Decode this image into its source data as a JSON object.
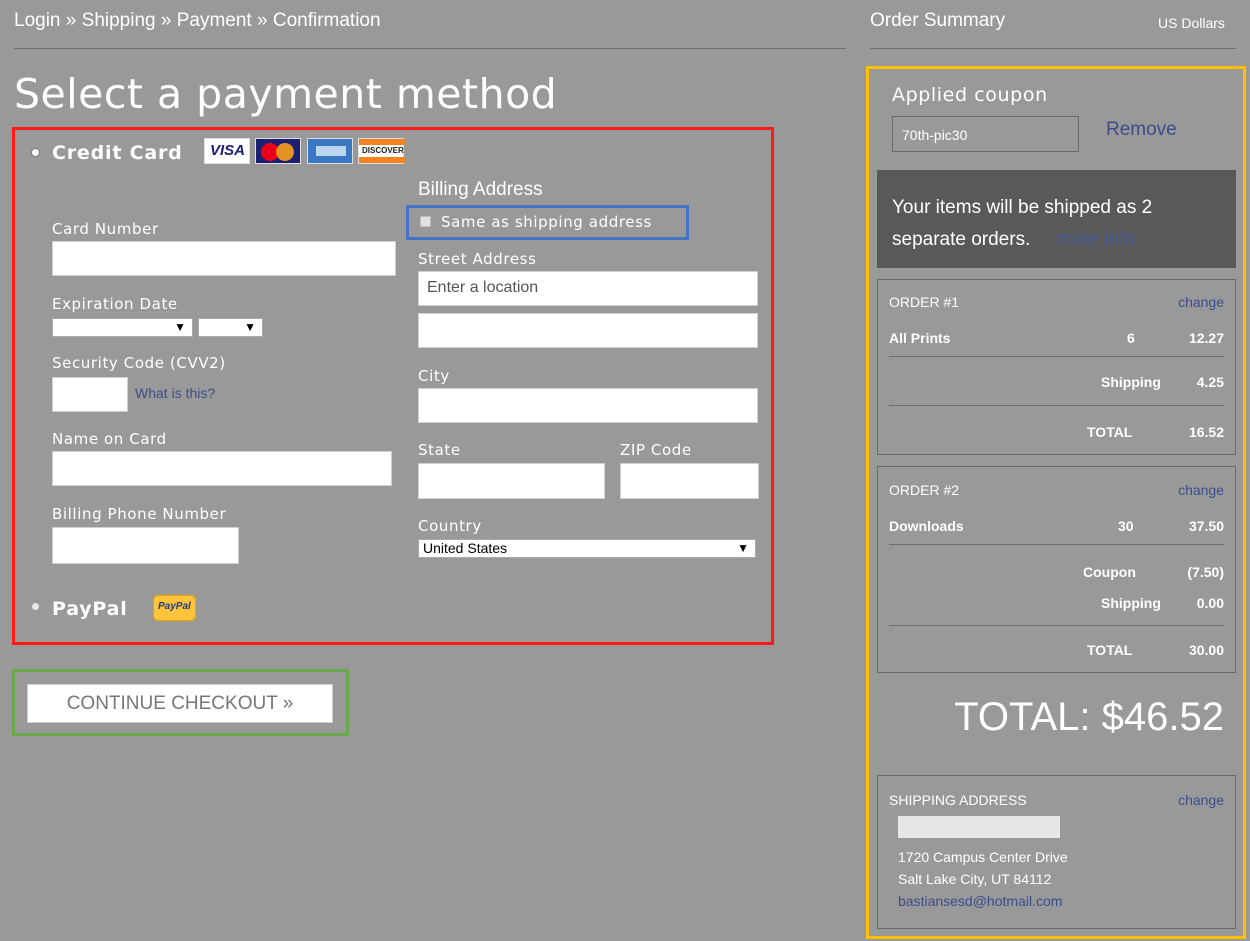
{
  "breadcrumb": [
    "Login",
    "»",
    "Shipping",
    "»",
    "Payment",
    "»",
    "Confirmation"
  ],
  "breadcrumb_text": "Login » Shipping » Payment » Confirmation",
  "page_title": "Select a payment method",
  "payment": {
    "credit_card_label": "Credit Card",
    "paypal_label": "PayPal",
    "card_brands": [
      "VISA",
      "MasterCard",
      "American Express",
      "DISCOVER"
    ],
    "paypal_badge": "PayPal",
    "card_number_label": "Card Number",
    "card_number_value": "",
    "expiration_label": "Expiration Date",
    "exp_month_value": "",
    "exp_year_value": "",
    "cvv_label": "Security Code (CVV2)",
    "cvv_value": "",
    "cvv_help": "What is this?",
    "name_label": "Name on Card",
    "name_value": "",
    "phone_label": "Billing Phone Number",
    "phone_value": ""
  },
  "billing": {
    "heading": "Billing Address",
    "same_as_shipping": "Same as shipping address",
    "street_label": "Street Address",
    "street_placeholder": "Enter a location",
    "street2_value": "",
    "city_label": "City",
    "city_value": "",
    "state_label": "State",
    "state_value": "",
    "zip_label": "ZIP Code",
    "zip_value": "",
    "country_label": "Country",
    "country_value": "United States"
  },
  "continue_button": "CONTINUE CHECKOUT »",
  "summary": {
    "title": "Order Summary",
    "currency": "US Dollars",
    "coupon_heading": "Applied coupon",
    "coupon_code": "70th-pic30",
    "coupon_remove": "Remove",
    "shipped_notice": "Your items will be shipped as 2 separate orders.",
    "more_info": "more info",
    "order1": {
      "title": "ORDER #1",
      "change": "change",
      "item_name": "All Prints",
      "item_qty": "6",
      "item_amount": "12.27",
      "shipping_label": "Shipping",
      "shipping_amount": "4.25",
      "total_label": "TOTAL",
      "total_amount": "16.52"
    },
    "order2": {
      "title": "ORDER #2",
      "change": "change",
      "item_name": "Downloads",
      "item_qty": "30",
      "item_amount": "37.50",
      "coupon_label": "Coupon",
      "coupon_amount": "(7.50)",
      "shipping_label": "Shipping",
      "shipping_amount": "0.00",
      "total_label": "TOTAL",
      "total_amount": "30.00"
    },
    "grand_total": "TOTAL: $46.52",
    "shipping_address": {
      "title": "SHIPPING ADDRESS",
      "change": "change",
      "line1": "1720 Campus Center Drive",
      "line2": "Salt Lake City, UT 84112",
      "email": "bastiansesd@hotmail.com"
    }
  },
  "colors": {
    "background": "#999999",
    "highlight_red": "#ff1a1a",
    "highlight_blue": "#4472c4",
    "highlight_green": "#6aa84f",
    "highlight_gold": "#ffc000",
    "link": "#3c4d8c"
  }
}
